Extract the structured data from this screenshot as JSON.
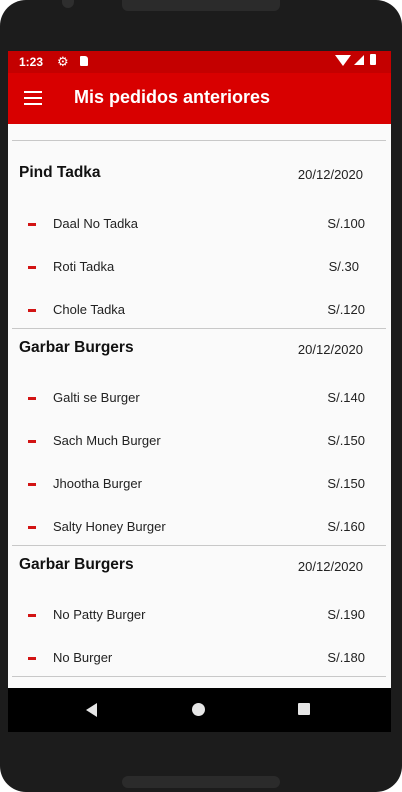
{
  "status": {
    "time": "1:23"
  },
  "appbar": {
    "title": "Mis pedidos anteriores",
    "menu_icon": "hamburger-menu-icon"
  },
  "colors": {
    "accent": "#d80000",
    "status_bar": "#c40000",
    "bullet": "#d21414"
  },
  "orders": [
    {
      "restaurant": "Pind Tadka",
      "date": "20/12/2020",
      "items": [
        {
          "name": "Daal No Tadka",
          "price": "S/.100"
        },
        {
          "name": "Roti Tadka",
          "price": "S/.30"
        },
        {
          "name": "Chole Tadka",
          "price": "S/.120"
        }
      ]
    },
    {
      "restaurant": "Garbar Burgers",
      "date": "20/12/2020",
      "items": [
        {
          "name": "Galti se Burger",
          "price": "S/.140"
        },
        {
          "name": "Sach Much Burger",
          "price": "S/.150"
        },
        {
          "name": "Jhootha Burger",
          "price": "S/.150"
        },
        {
          "name": "Salty Honey Burger",
          "price": "S/.160"
        }
      ]
    },
    {
      "restaurant": "Garbar Burgers",
      "date": "20/12/2020",
      "items": [
        {
          "name": "No Patty Burger",
          "price": "S/.190"
        },
        {
          "name": "No Burger",
          "price": "S/.180"
        }
      ]
    }
  ],
  "navbar": {
    "back_icon": "back-triangle-icon",
    "home_icon": "home-circle-icon",
    "recent_icon": "recents-square-icon"
  }
}
